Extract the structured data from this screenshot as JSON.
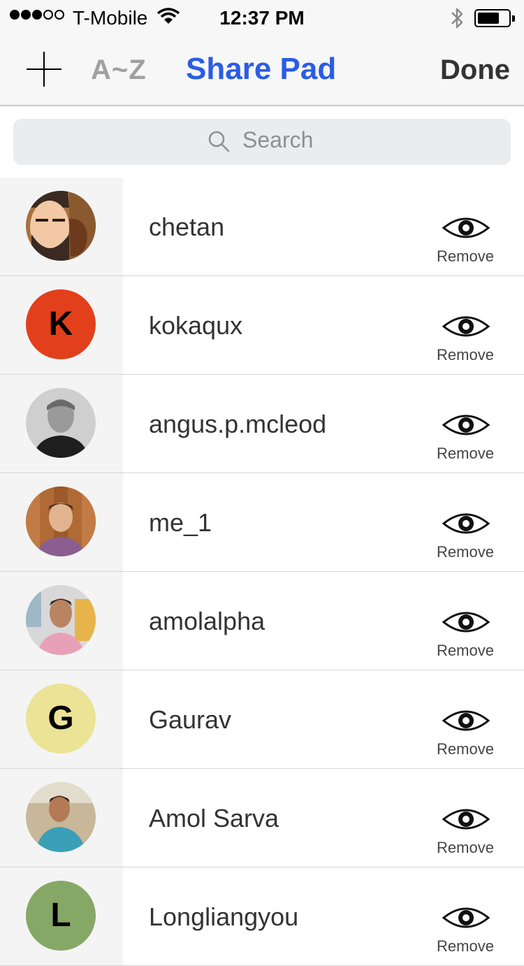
{
  "status_bar": {
    "carrier": "T-Mobile",
    "time": "12:37 PM",
    "signal_bars": 3,
    "signal_total": 5
  },
  "nav": {
    "az_label": "A~Z",
    "title": "Share Pad",
    "done_label": "Done",
    "accent": "#2a5ce6"
  },
  "search": {
    "placeholder": "Search"
  },
  "users": [
    {
      "name": "chetan",
      "action": "Remove",
      "avatar": "photo"
    },
    {
      "name": "kokaqux",
      "action": "Remove",
      "avatar": "letter",
      "letter": "K",
      "color": "#e2401c"
    },
    {
      "name": "angus.p.mcleod",
      "action": "Remove",
      "avatar": "photo"
    },
    {
      "name": "me_1",
      "action": "Remove",
      "avatar": "photo"
    },
    {
      "name": "amolalpha",
      "action": "Remove",
      "avatar": "photo"
    },
    {
      "name": "Gaurav",
      "action": "Remove",
      "avatar": "letter",
      "letter": "G",
      "color": "#ebe396"
    },
    {
      "name": "Amol Sarva",
      "action": "Remove",
      "avatar": "photo"
    },
    {
      "name": "Longliangyou",
      "action": "Remove",
      "avatar": "letter",
      "letter": "L",
      "color": "#86a866"
    }
  ]
}
